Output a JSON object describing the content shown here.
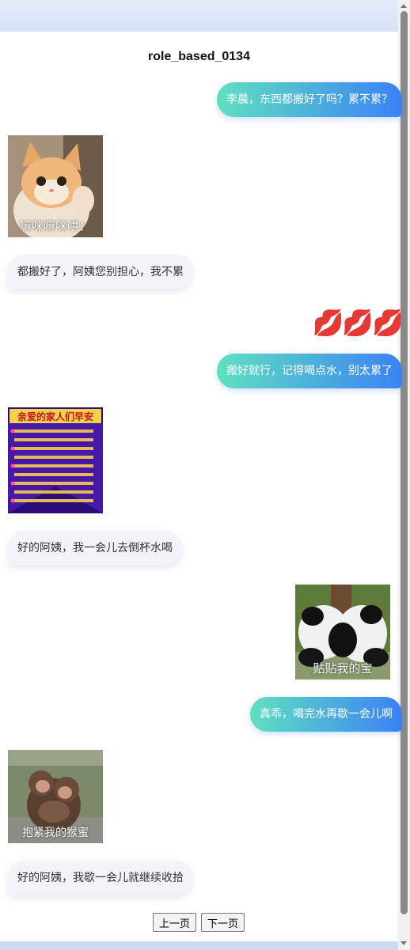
{
  "page": {
    "title": "role_based_0134"
  },
  "messages": [
    {
      "side": "right",
      "text": "李晨，东西都搬好了吗？累不累？"
    },
    {
      "side": "left",
      "sticker": "kitten-sticker",
      "caption": "嘛咪嘛咪哄！"
    },
    {
      "side": "left",
      "text": "都搬好了，阿姨您别担心，我不累"
    },
    {
      "side": "right",
      "emoji": "💋💋💋"
    },
    {
      "side": "right",
      "text": "搬好就行，记得喝点水，别太累了"
    },
    {
      "side": "left",
      "sticker": "greeting-card-sticker",
      "caption": "亲爱的家人们早安"
    },
    {
      "side": "left",
      "text": "好的阿姨，我一会儿去倒杯水喝"
    },
    {
      "side": "right",
      "sticker": "pandas-hugging-sticker",
      "caption": "贴贴我的宝"
    },
    {
      "side": "right",
      "text": "真乖，喝完水再歇一会儿啊"
    },
    {
      "side": "left",
      "sticker": "monkeys-hugging-sticker",
      "caption": "抱紧我的猴蜜"
    },
    {
      "side": "left",
      "text": "好的阿姨，我歇一会儿就继续收拾"
    }
  ],
  "pagination": {
    "prev_label": "上一页",
    "next_label": "下一页"
  },
  "colors": {
    "bubble_gradient_start": "#5fe0c0",
    "bubble_gradient_end": "#3b82f6",
    "left_bubble": "#f3f4f8"
  }
}
